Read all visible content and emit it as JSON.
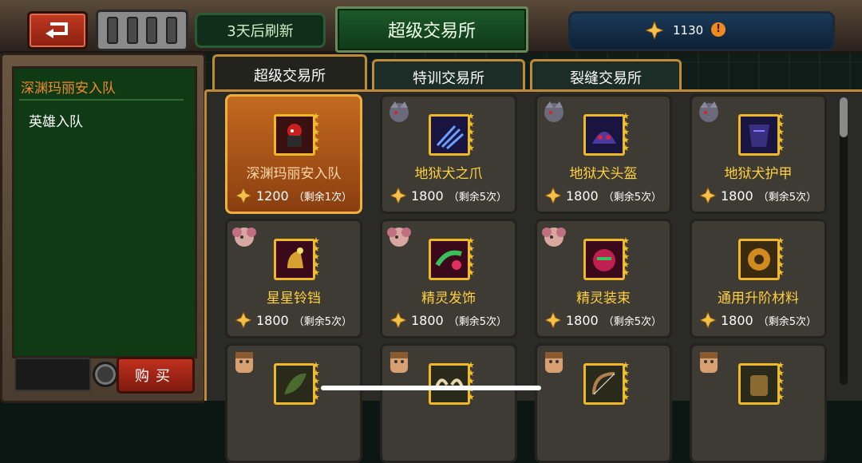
{
  "header": {
    "refresh_text": "3天后刷新",
    "title": "超级交易所",
    "currency_amount": "1130",
    "currency_icon": "gem-icon",
    "info_symbol": "!"
  },
  "left_panel": {
    "item_title": "深渊玛丽安入队",
    "item_desc": "英雄入队",
    "buy_label": "购买"
  },
  "tabs": [
    {
      "label": "超级交易所",
      "active": true
    },
    {
      "label": "特训交易所",
      "active": false
    },
    {
      "label": "裂缝交易所",
      "active": false
    }
  ],
  "items": [
    {
      "name": "深渊玛丽安入队",
      "price": "1200",
      "remain": "（剩余1次）",
      "icon": "hero-marian-icon",
      "portrait": "",
      "selected": true
    },
    {
      "name": "地狱犬之爪",
      "price": "1800",
      "remain": "（剩余5次）",
      "icon": "claw-icon",
      "portrait": "hellhound-portrait"
    },
    {
      "name": "地狱犬头盔",
      "price": "1800",
      "remain": "（剩余5次）",
      "icon": "helmet-icon",
      "portrait": "hellhound-portrait"
    },
    {
      "name": "地狱犬护甲",
      "price": "1800",
      "remain": "（剩余5次）",
      "icon": "armor-icon",
      "portrait": "hellhound-portrait"
    },
    {
      "name": "星星铃铛",
      "price": "1800",
      "remain": "（剩余5次）",
      "icon": "bell-icon",
      "portrait": "elf-portrait"
    },
    {
      "name": "精灵发饰",
      "price": "1800",
      "remain": "（剩余5次）",
      "icon": "hair-ornament-icon",
      "portrait": "elf-portrait"
    },
    {
      "name": "精灵装束",
      "price": "1800",
      "remain": "（剩余5次）",
      "icon": "outfit-icon",
      "portrait": "elf-portrait"
    },
    {
      "name": "通用升阶材料",
      "price": "1800",
      "remain": "（剩余5次）",
      "icon": "gear-icon",
      "portrait": ""
    },
    {
      "name": "",
      "price": "",
      "remain": "",
      "icon": "leaf-icon",
      "portrait": "soldier-portrait"
    },
    {
      "name": "",
      "price": "",
      "remain": "",
      "icon": "horns-icon",
      "portrait": "soldier-portrait"
    },
    {
      "name": "",
      "price": "",
      "remain": "",
      "icon": "bow-icon",
      "portrait": "soldier-portrait"
    },
    {
      "name": "",
      "price": "",
      "remain": "",
      "icon": "glove-icon",
      "portrait": "soldier-portrait"
    }
  ],
  "colors": {
    "accent_gold": "#f0b828",
    "title_green": "#1c5a2a",
    "selected_orange": "#c46a20"
  }
}
